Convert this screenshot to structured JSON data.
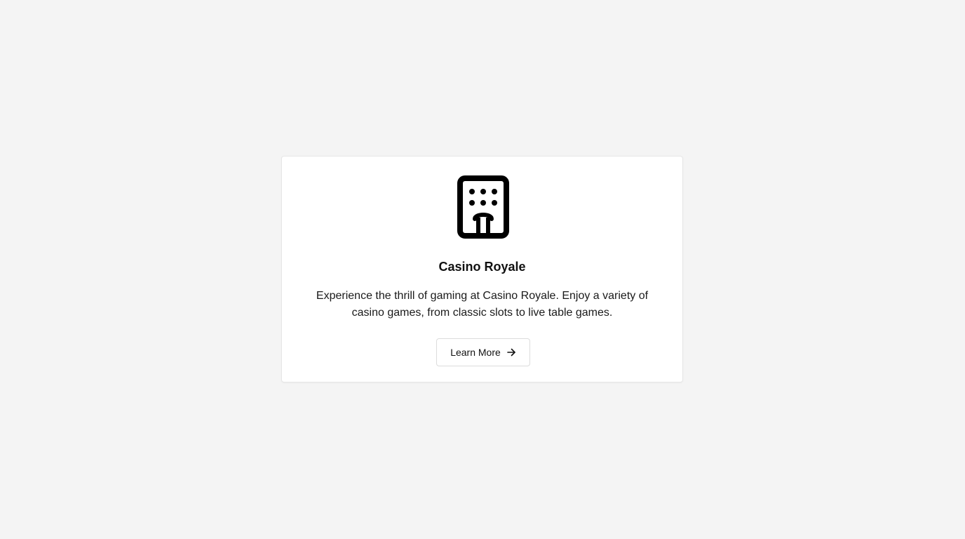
{
  "card": {
    "icon": "building-icon",
    "title": "Casino Royale",
    "description": "Experience the thrill of gaming at Casino Royale. Enjoy a variety of casino games, from classic slots to live table games.",
    "button_label": "Learn More",
    "button_icon": "arrow-right-icon"
  },
  "colors": {
    "page_background": "#f4f4f4",
    "card_background": "#ffffff",
    "text": "#111111"
  }
}
